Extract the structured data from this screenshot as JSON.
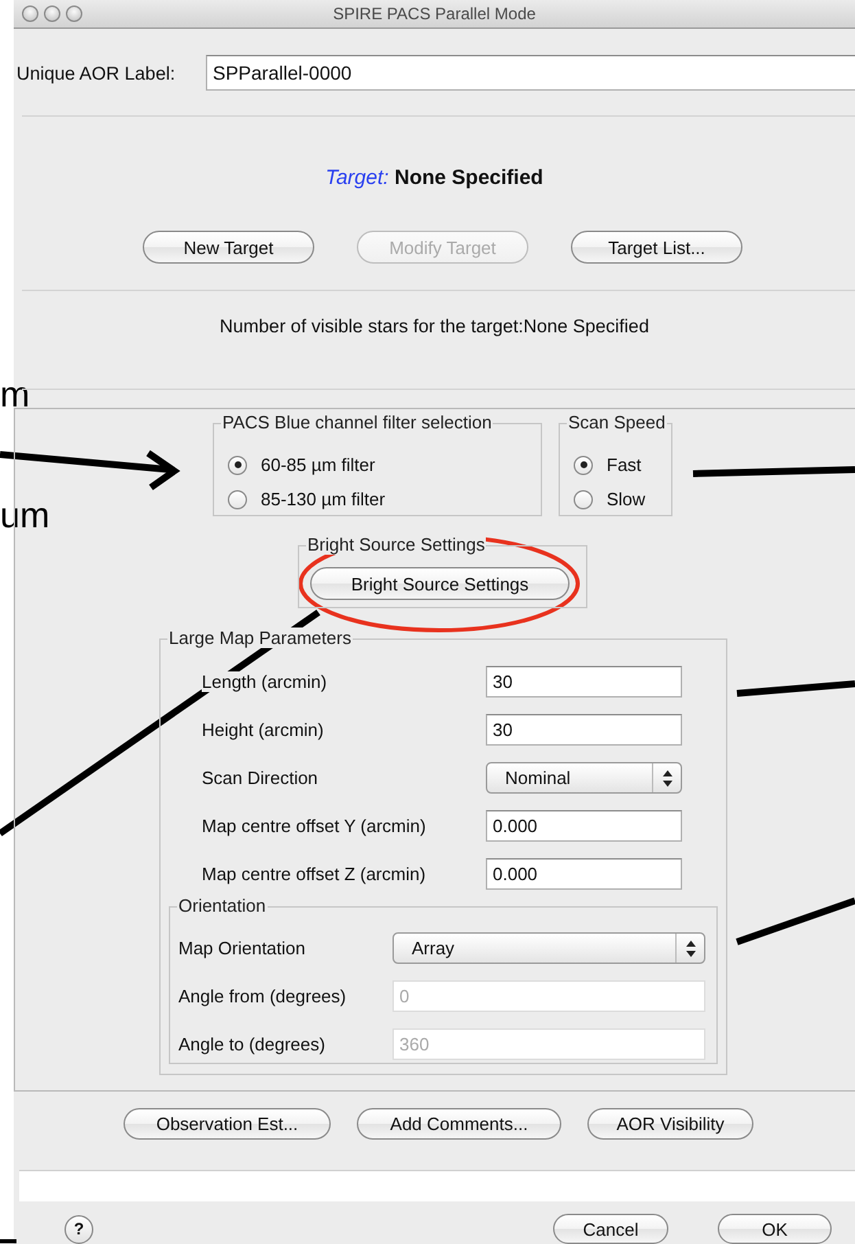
{
  "window": {
    "title": "SPIRE PACS Parallel Mode"
  },
  "aor_label": {
    "label": "Unique AOR Label:",
    "value": "SPParallel-0000"
  },
  "target": {
    "label": "Target:",
    "value": "None Specified"
  },
  "target_buttons": [
    {
      "label": "New Target",
      "disabled": false
    },
    {
      "label": "Modify Target",
      "disabled": true
    },
    {
      "label": "Target List...",
      "disabled": false
    }
  ],
  "visible_stars": "Number of visible stars for the target:None Specified",
  "filter_group": {
    "title": "PACS Blue channel filter selection",
    "options": [
      {
        "label": "60-85 µm filter",
        "selected": true
      },
      {
        "label": "85-130 µm filter",
        "selected": false
      }
    ]
  },
  "scan_speed": {
    "title": "Scan Speed",
    "options": [
      {
        "label": "Fast",
        "selected": true
      },
      {
        "label": "Slow",
        "selected": false
      }
    ]
  },
  "bright_source": {
    "title": "Bright Source Settings",
    "button": "Bright Source Settings"
  },
  "large_map": {
    "title": "Large Map Parameters",
    "rows": [
      {
        "label": "Length (arcmin)",
        "kind": "text",
        "value": "30"
      },
      {
        "label": "Height (arcmin)",
        "kind": "text",
        "value": "30"
      },
      {
        "label": "Scan Direction",
        "kind": "select",
        "value": "Nominal"
      },
      {
        "label": "Map centre offset Y (arcmin)",
        "kind": "text",
        "value": "0.000"
      },
      {
        "label": "Map centre offset Z (arcmin)",
        "kind": "text",
        "value": "0.000"
      }
    ]
  },
  "orientation": {
    "title": "Orientation",
    "rows": [
      {
        "label": "Map Orientation",
        "kind": "select",
        "value": "Array",
        "disabled": false
      },
      {
        "label": "Angle from (degrees)",
        "kind": "text",
        "value": "0",
        "disabled": true
      },
      {
        "label": "Angle to (degrees)",
        "kind": "text",
        "value": "360",
        "disabled": true
      }
    ]
  },
  "bottom_buttons": [
    "Observation Est...",
    "Add Comments...",
    "AOR Visibility"
  ],
  "dialog_buttons": [
    {
      "kind": "help",
      "label": "?"
    },
    {
      "kind": "push",
      "label": "Cancel"
    },
    {
      "kind": "push",
      "label": "OK"
    }
  ],
  "annotations": {
    "labels": [
      "m",
      "um"
    ]
  }
}
